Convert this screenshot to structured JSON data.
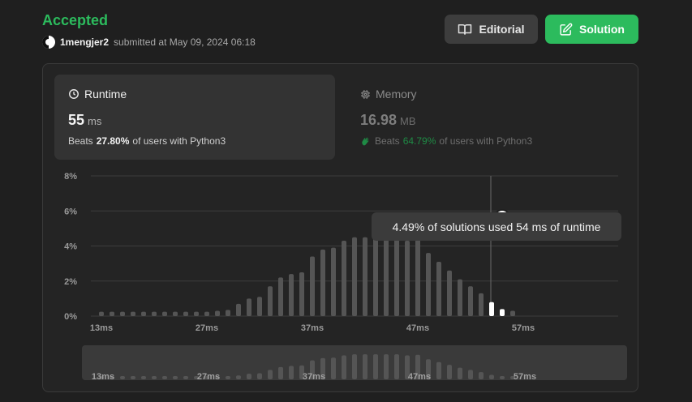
{
  "header": {
    "status": "Accepted",
    "user": "1mengjer2",
    "submitted_text": "submitted at May 09, 2024 06:18"
  },
  "buttons": {
    "editorial": "Editorial",
    "solution": "Solution"
  },
  "runtime": {
    "label": "Runtime",
    "value": "55",
    "unit": "ms",
    "beats_label": "Beats",
    "beats_pct": "27.80%",
    "beats_suffix": "of users with Python3"
  },
  "memory": {
    "label": "Memory",
    "value": "16.98",
    "unit": "MB",
    "beats_label": "Beats",
    "beats_pct": "64.79%",
    "beats_suffix": "of users with Python3"
  },
  "tooltip": "4.49% of solutions used 54 ms of runtime",
  "colors": {
    "accent": "#2cbb5d",
    "bar": "#555555",
    "bar_highlight": "#ffffff"
  },
  "icons": {
    "editorial": "book-icon",
    "solution": "edit-icon",
    "runtime": "clock-icon",
    "memory": "chip-icon",
    "memory_beats": "clap-icon"
  },
  "chart_data": {
    "type": "bar",
    "x": [
      13,
      15,
      17,
      19,
      21,
      23,
      25,
      27,
      29,
      31,
      33,
      35,
      37,
      39,
      41,
      43,
      45,
      47,
      49,
      51,
      53,
      54,
      55,
      57,
      59,
      61,
      63,
      65,
      67,
      69,
      71
    ],
    "values": [
      0.25,
      0.25,
      0.25,
      0.25,
      0.25,
      0.25,
      0.25,
      0.25,
      0.25,
      0.25,
      0.25,
      0.3,
      0.35,
      0.7,
      1.0,
      1.1,
      1.7,
      2.2,
      2.4,
      2.5,
      3.4,
      3.8,
      3.9,
      4.3,
      4.5,
      4.5,
      4.5,
      4.5,
      4.49,
      4.3,
      4.4,
      3.6,
      3.1,
      2.6,
      2.1,
      1.7,
      1.3,
      0.8,
      0.4,
      0.3
    ],
    "highlight": [
      54,
      55
    ],
    "xticks": [
      "13ms",
      "27ms",
      "37ms",
      "47ms",
      "57ms"
    ],
    "yticks": [
      "8%",
      "6%",
      "4%",
      "2%",
      "0%"
    ],
    "ylim": [
      0,
      8
    ],
    "grid": true
  }
}
